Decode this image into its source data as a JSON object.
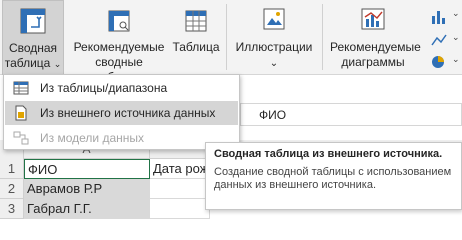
{
  "ribbon": {
    "pivot_line1": "Сводная",
    "pivot_line2": "таблица",
    "recommended_line1": "Рекомендуемые",
    "recommended_line2": "сводные таблицы",
    "table_label": "Таблица",
    "illustrations_label": "Иллюстрации",
    "rec_charts_line1": "Рекомендуемые",
    "rec_charts_line2": "диаграммы",
    "accent_color": "#217346"
  },
  "menu": {
    "items": [
      {
        "label": "Из таблицы/диапазона",
        "state": "normal"
      },
      {
        "label": "Из внешнего источника данных",
        "state": "hover"
      },
      {
        "label": "Из модели данных",
        "state": "disabled"
      }
    ]
  },
  "formula_bar": {
    "value": "ФИО"
  },
  "sheet": {
    "column_header": "A",
    "rows": [
      {
        "num": "1",
        "a": "ФИО",
        "b": "Дата рож"
      },
      {
        "num": "2",
        "a": "Аврамов Р.Р",
        "b": ""
      },
      {
        "num": "3",
        "a": "Габрал Г.Г.",
        "b": ""
      }
    ]
  },
  "tooltip": {
    "title": "Сводная таблица из внешнего источника.",
    "body": "Создание сводной таблицы с использованием данных из внешнего источника."
  }
}
